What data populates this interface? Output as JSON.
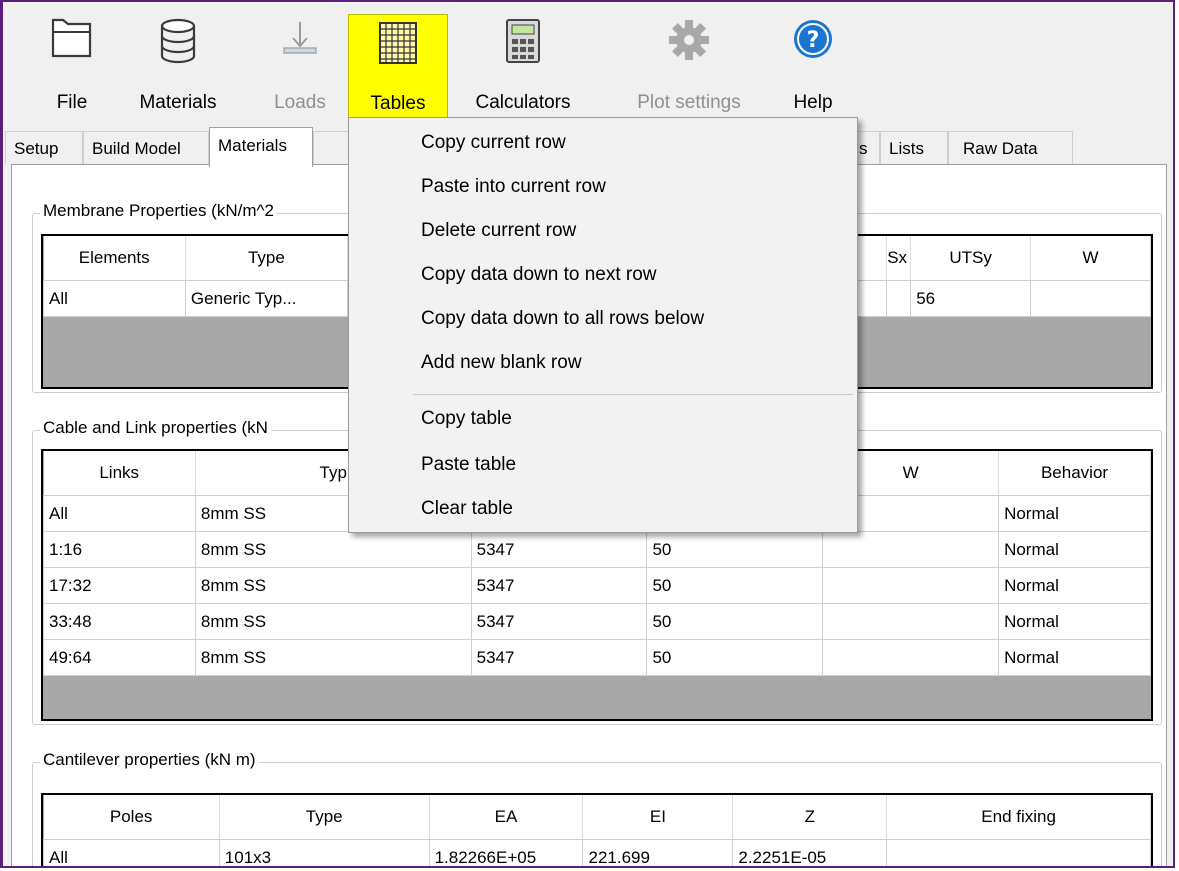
{
  "toolbar": {
    "file": "File",
    "materials": "Materials",
    "loads": "Loads",
    "tables": "Tables",
    "calculators": "Calculators",
    "plot_settings": "Plot settings",
    "help": "Help"
  },
  "tabs": [
    "Setup",
    "Build Model",
    "Materials",
    "s",
    "Lists",
    "Raw Data"
  ],
  "membrane": {
    "title": "Membrane Properties (kN/m^2",
    "headers": [
      "Elements",
      "Type",
      "",
      "Sx",
      "UTSy",
      "W"
    ],
    "rows": [
      [
        "All",
        "Generic Typ...",
        "",
        "",
        "56",
        ""
      ]
    ]
  },
  "cable": {
    "title": "Cable and Link properties (kN",
    "headers": [
      "Links",
      "Typ",
      "",
      "",
      "W",
      "Behavior"
    ],
    "rows": [
      [
        "All",
        "8mm SS",
        "",
        "",
        "",
        "Normal"
      ],
      [
        "1:16",
        "8mm SS",
        "5347",
        "50",
        "",
        "Normal"
      ],
      [
        "17:32",
        "8mm SS",
        "5347",
        "50",
        "",
        "Normal"
      ],
      [
        "33:48",
        "8mm SS",
        "5347",
        "50",
        "",
        "Normal"
      ],
      [
        "49:64",
        "8mm SS",
        "5347",
        "50",
        "",
        "Normal"
      ]
    ]
  },
  "cantilever": {
    "title": "Cantilever properties (kN m)",
    "headers": [
      "Poles",
      "Type",
      "EA",
      "EI",
      "Z",
      "End fixing"
    ],
    "rows": [
      [
        "All",
        "101x3",
        "1.82266E+05",
        "221.699",
        "2.2251E-05",
        ""
      ]
    ]
  },
  "menu": {
    "items": [
      "Copy current row",
      "Paste into current row",
      "Delete current row",
      "Copy data down to next row",
      "Copy data down to all rows below",
      "Add new blank row",
      "Copy table",
      "Paste table",
      "Clear table"
    ]
  }
}
